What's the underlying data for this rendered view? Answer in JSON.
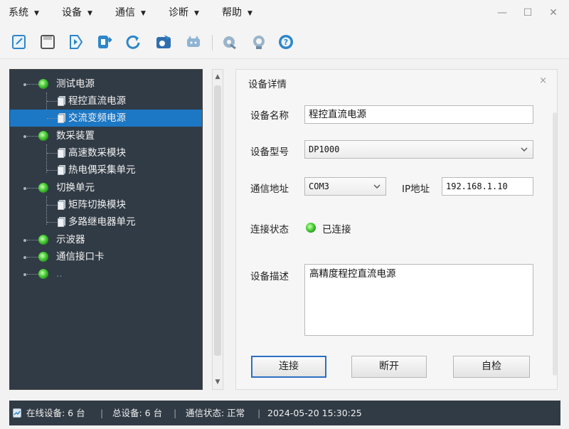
{
  "menu": {
    "items": [
      {
        "label": "系统"
      },
      {
        "label": "设备"
      },
      {
        "label": "通信"
      },
      {
        "label": "诊断"
      },
      {
        "label": "帮助"
      }
    ],
    "arrow": "▼"
  },
  "window_controls": {
    "minimize": "—",
    "maximize": "☐",
    "close": "✕"
  },
  "toolbar": {
    "icons": [
      "new-icon",
      "save-icon",
      "run-icon",
      "export-icon",
      "refresh-icon",
      "camera-icon",
      "device-icon",
      "settings-icon",
      "sync-icon",
      "help-icon"
    ]
  },
  "tree": {
    "nodes": [
      {
        "label": "测试电源",
        "type": "group"
      },
      {
        "label": "程控直流电源",
        "type": "child"
      },
      {
        "label": "交流变频电源",
        "type": "child",
        "selected": true
      },
      {
        "label": "数采装置",
        "type": "group"
      },
      {
        "label": "高速数采模块",
        "type": "child"
      },
      {
        "label": "热电偶采集单元",
        "type": "child"
      },
      {
        "label": "切换单元",
        "type": "group"
      },
      {
        "label": "矩阵切换模块",
        "type": "child"
      },
      {
        "label": "多路继电器单元",
        "type": "child"
      },
      {
        "label": "示波器",
        "type": "group"
      },
      {
        "label": "通信接口卡",
        "type": "group"
      },
      {
        "label": "..",
        "type": "group"
      }
    ]
  },
  "scroll": {
    "up": "▲",
    "down": "▼"
  },
  "detail": {
    "title": "设备详情",
    "close": "×",
    "name_label": "设备名称",
    "name_value": "程控直流电源",
    "model_label": "设备型号",
    "model_value": "DP1000",
    "comm_label": "通信地址",
    "comm_value": "COM3",
    "ip_label": "IP地址",
    "ip_value": "192.168.1.10",
    "status_label": "连接状态",
    "status_value": "已连接",
    "desc_label": "设备描述",
    "desc_value": "高精度程控直流电源",
    "buttons": {
      "connect": "连接",
      "disconnect": "断开",
      "selftest": "自检"
    }
  },
  "statusbar": {
    "online": "在线设备: 6 台",
    "total": "总设备: 6 台",
    "comm": "通信状态: 正常",
    "time": "2024-05-20 15:30:25",
    "sep": "|"
  },
  "colors": {
    "tree_bg": "#313b45",
    "selection": "#1c77c4",
    "status_ok": "#4cd03a",
    "primary_border": "#2c6fc2"
  }
}
